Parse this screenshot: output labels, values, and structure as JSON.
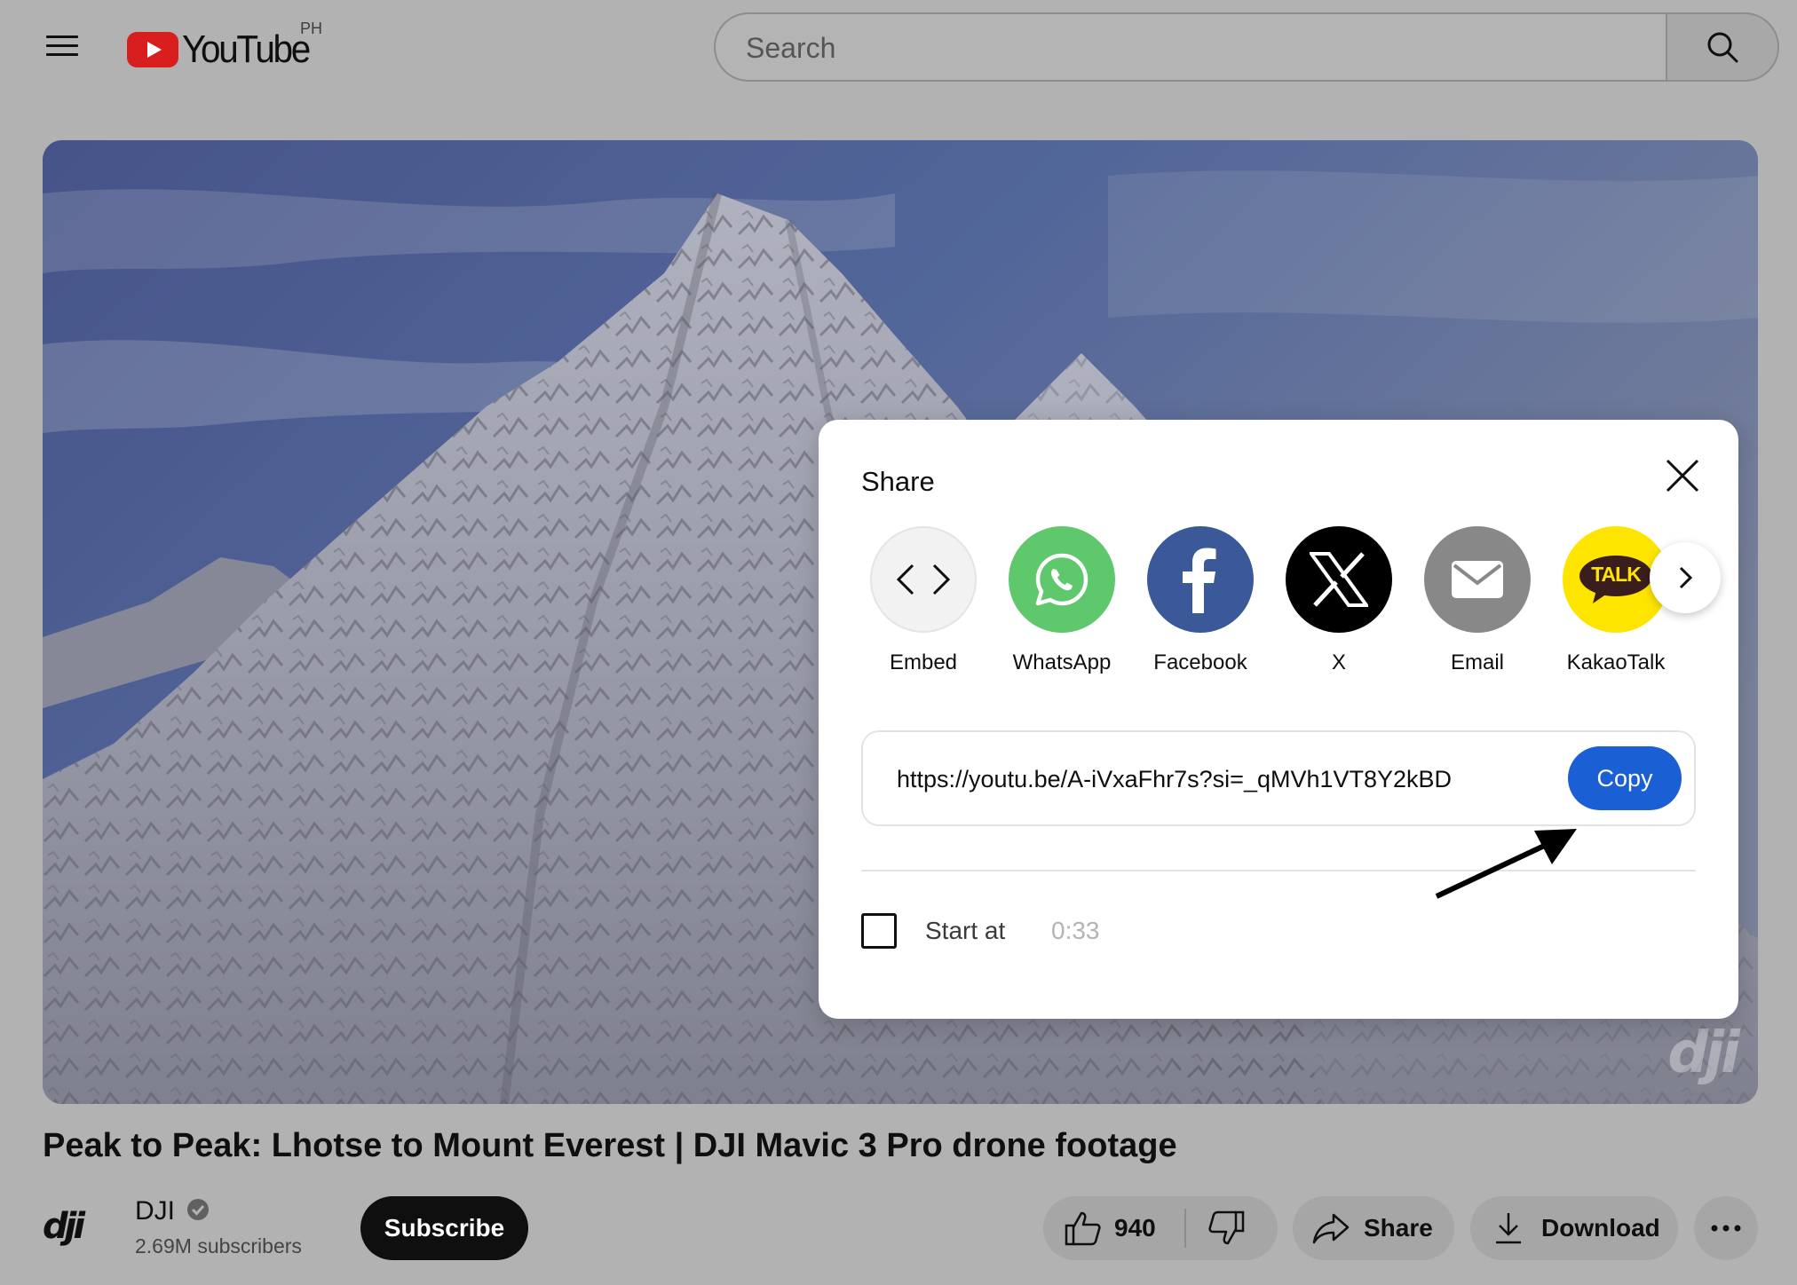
{
  "header": {
    "logo_text": "YouTube",
    "country_code": "PH",
    "search_placeholder": "Search"
  },
  "video": {
    "watermark": "dji",
    "title": "Peak to Peak: Lhotse to Mount Everest | DJI Mavic 3 Pro drone footage"
  },
  "share_dialog": {
    "title": "Share",
    "targets": [
      {
        "label": "Embed",
        "icon": "embed-icon",
        "color": "#f2f2f2"
      },
      {
        "label": "WhatsApp",
        "icon": "whatsapp-icon",
        "color": "#5fc86c"
      },
      {
        "label": "Facebook",
        "icon": "facebook-icon",
        "color": "#3b5998"
      },
      {
        "label": "X",
        "icon": "x-icon",
        "color": "#000000"
      },
      {
        "label": "Email",
        "icon": "email-icon",
        "color": "#888888"
      },
      {
        "label": "KakaoTalk",
        "icon": "kakaotalk-icon",
        "color": "#fee500"
      }
    ],
    "kakao_badge": "TALK",
    "url": "https://youtu.be/A-iVxaFhr7s?si=_qMVh1VT8Y2kBD",
    "copy_label": "Copy",
    "start_at_label": "Start at",
    "start_at_time": "0:33",
    "copy_button_color": "#1a5fd4"
  },
  "channel": {
    "logo_text": "dji",
    "name": "DJI",
    "subscribers": "2.69M subscribers",
    "subscribe_label": "Subscribe"
  },
  "actions": {
    "like_count": "940",
    "share_label": "Share",
    "download_label": "Download"
  }
}
